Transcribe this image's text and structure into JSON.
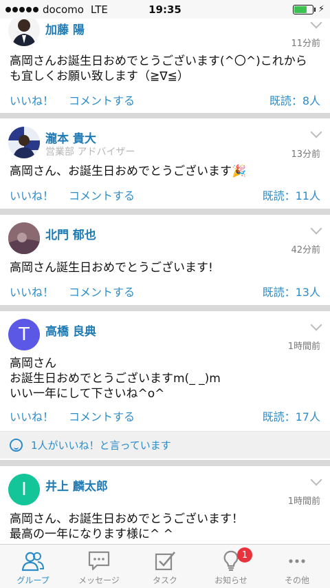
{
  "status_bar": {
    "carrier": "docomo",
    "network": "LTE",
    "time": "19:35"
  },
  "posts": [
    {
      "name": "加藤 陽",
      "dept": "",
      "time": "11分前",
      "body": "高岡さんお誕生日おめでとうございます(^〇^)これから\nも宜しくお願い致します（≧∇≦）",
      "like": "いいね！",
      "comment": "コメントする",
      "read": "既読：8人"
    },
    {
      "name": "瀧本 貴大",
      "dept": "営業部 アドバイザー",
      "time": "13分前",
      "body": "高岡さん、お誕生日おめでとうございます🎉",
      "like": "いいね！",
      "comment": "コメントする",
      "read": "既読：11人"
    },
    {
      "name": "北門 郁也",
      "dept": "",
      "time": "42分前",
      "body": "高岡さん誕生日おめでとうございます!",
      "like": "いいね！",
      "comment": "コメントする",
      "read": "既読：13人"
    },
    {
      "name": "高橋 良典",
      "dept": "",
      "initial": "T",
      "time": "1時間前",
      "body": "高岡さん\nお誕生日おめでとうございますm(_ _)m\nいい一年にして下さいね^o^",
      "like": "いいね！",
      "comment": "コメントする",
      "read": "既読：17人",
      "likes_summary": "1人がいいね！と言っています"
    },
    {
      "name": "井上 麟太郎",
      "dept": "",
      "initial": "I",
      "time": "1時間前",
      "body": "高岡さん、お誕生日おめでとうございます！\n最高の一年になります様に^ ^"
    }
  ],
  "tabs": [
    {
      "label": "グループ",
      "icon": "group-icon",
      "active": true
    },
    {
      "label": "メッセージ",
      "icon": "message-icon"
    },
    {
      "label": "タスク",
      "icon": "task-icon"
    },
    {
      "label": "お知らせ",
      "icon": "notification-icon",
      "badge": "1"
    },
    {
      "label": "その他",
      "icon": "more-icon"
    }
  ],
  "colors": {
    "accent": "#2d8cc8",
    "name": "#1f7bb5",
    "badge": "#e8323c",
    "avatar_t": "#5b58e6",
    "avatar_i": "#14c59a"
  }
}
